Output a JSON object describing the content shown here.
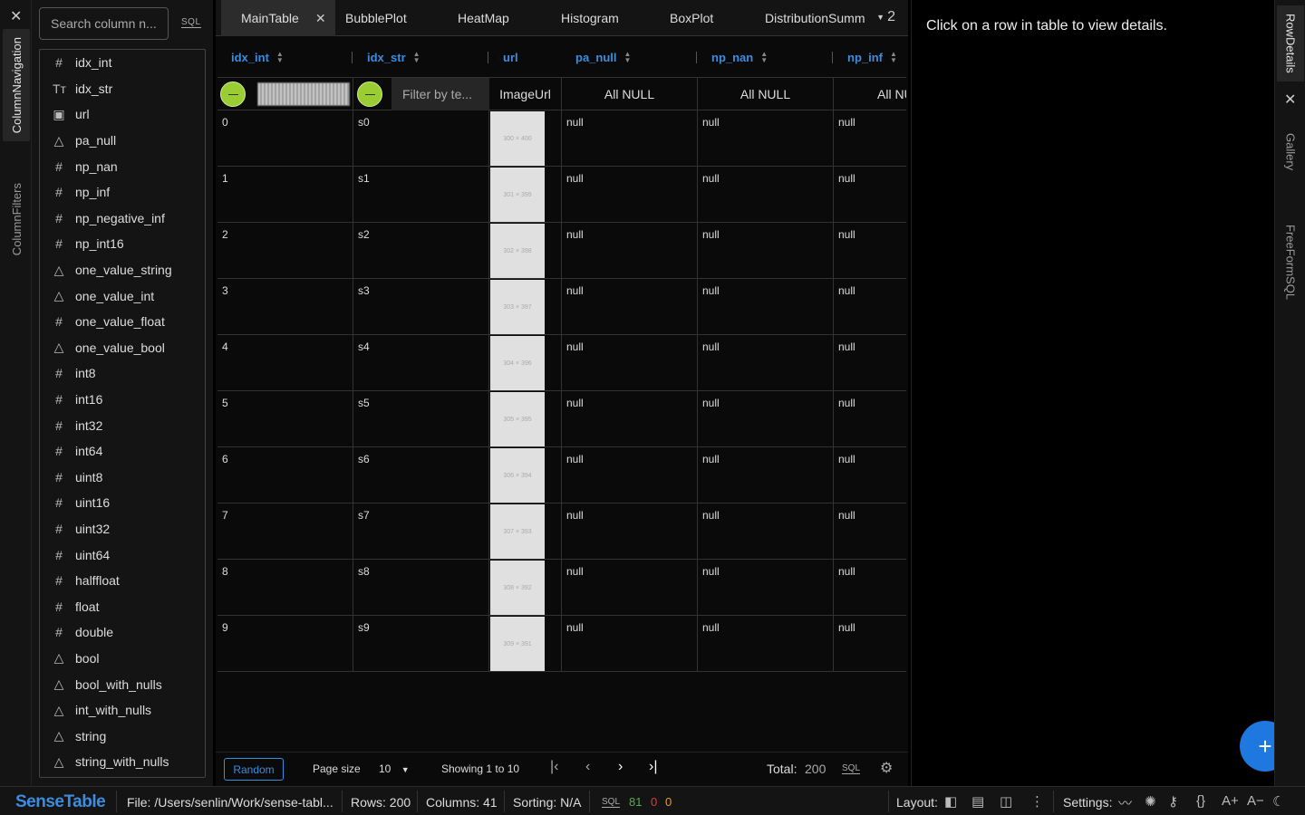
{
  "left_panel": {
    "tabs": [
      "ColumnNavigation",
      "ColumnFilters"
    ],
    "search_placeholder": "Search column n...",
    "sql_label": "SQL",
    "columns": [
      {
        "icon": "#",
        "name": "idx_int"
      },
      {
        "icon": "Tт",
        "name": "idx_str"
      },
      {
        "icon": "▣",
        "name": "url"
      },
      {
        "icon": "△",
        "name": "pa_null"
      },
      {
        "icon": "#",
        "name": "np_nan"
      },
      {
        "icon": "#",
        "name": "np_inf"
      },
      {
        "icon": "#",
        "name": "np_negative_inf"
      },
      {
        "icon": "#",
        "name": "np_int16"
      },
      {
        "icon": "△",
        "name": "one_value_string"
      },
      {
        "icon": "△",
        "name": "one_value_int"
      },
      {
        "icon": "#",
        "name": "one_value_float"
      },
      {
        "icon": "△",
        "name": "one_value_bool"
      },
      {
        "icon": "#",
        "name": "int8"
      },
      {
        "icon": "#",
        "name": "int16"
      },
      {
        "icon": "#",
        "name": "int32"
      },
      {
        "icon": "#",
        "name": "int64"
      },
      {
        "icon": "#",
        "name": "uint8"
      },
      {
        "icon": "#",
        "name": "uint16"
      },
      {
        "icon": "#",
        "name": "uint32"
      },
      {
        "icon": "#",
        "name": "uint64"
      },
      {
        "icon": "#",
        "name": "halffloat"
      },
      {
        "icon": "#",
        "name": "float"
      },
      {
        "icon": "#",
        "name": "double"
      },
      {
        "icon": "△",
        "name": "bool"
      },
      {
        "icon": "△",
        "name": "bool_with_nulls"
      },
      {
        "icon": "△",
        "name": "int_with_nulls"
      },
      {
        "icon": "△",
        "name": "string"
      },
      {
        "icon": "△",
        "name": "string_with_nulls"
      }
    ]
  },
  "tabs": {
    "items": [
      "MainTable",
      "BubblePlot",
      "HeatMap",
      "Histogram",
      "BoxPlot",
      "DistributionSumm"
    ],
    "active": "MainTable",
    "overflow_count": "2"
  },
  "table": {
    "headers": [
      "idx_int",
      "idx_str",
      "url",
      "pa_null",
      "np_nan",
      "np_inf"
    ],
    "filters": {
      "str_placeholder": "Filter by te...",
      "url": "ImageUrl",
      "pa_null": "All NULL",
      "np_nan": "All NULL",
      "np_inf": "All NU"
    },
    "rows": [
      {
        "idx_int": "0",
        "idx_str": "s0",
        "img": "300 × 400",
        "pa_null": "null",
        "np_nan": "null",
        "np_inf": "null"
      },
      {
        "idx_int": "1",
        "idx_str": "s1",
        "img": "301 × 399",
        "pa_null": "null",
        "np_nan": "null",
        "np_inf": "null"
      },
      {
        "idx_int": "2",
        "idx_str": "s2",
        "img": "302 × 398",
        "pa_null": "null",
        "np_nan": "null",
        "np_inf": "null"
      },
      {
        "idx_int": "3",
        "idx_str": "s3",
        "img": "303 × 397",
        "pa_null": "null",
        "np_nan": "null",
        "np_inf": "null"
      },
      {
        "idx_int": "4",
        "idx_str": "s4",
        "img": "304 × 396",
        "pa_null": "null",
        "np_nan": "null",
        "np_inf": "null"
      },
      {
        "idx_int": "5",
        "idx_str": "s5",
        "img": "305 × 395",
        "pa_null": "null",
        "np_nan": "null",
        "np_inf": "null"
      },
      {
        "idx_int": "6",
        "idx_str": "s6",
        "img": "306 × 394",
        "pa_null": "null",
        "np_nan": "null",
        "np_inf": "null"
      },
      {
        "idx_int": "7",
        "idx_str": "s7",
        "img": "307 × 393",
        "pa_null": "null",
        "np_nan": "null",
        "np_inf": "null"
      },
      {
        "idx_int": "8",
        "idx_str": "s8",
        "img": "308 × 392",
        "pa_null": "null",
        "np_nan": "null",
        "np_inf": "null"
      },
      {
        "idx_int": "9",
        "idx_str": "s9",
        "img": "309 × 391",
        "pa_null": "null",
        "np_nan": "null",
        "np_inf": "null"
      }
    ]
  },
  "footer": {
    "random_label": "Random",
    "page_size_label": "Page size",
    "page_size_value": "10",
    "showing": "Showing 1 to 10",
    "total_label": "Total:",
    "total_value": "200",
    "sql_label": "SQL"
  },
  "details": {
    "message": "Click on a row in table to view details."
  },
  "right_panel": {
    "tabs": [
      "RowDetails",
      "Gallery",
      "FreeFormSQL"
    ]
  },
  "status_bar": {
    "brand": "SenseTable",
    "file": "File: /Users/senlin/Work/sense-tabl...",
    "rows": "Rows: 200",
    "columns": "Columns: 41",
    "sorting": "Sorting: N/A",
    "sql_label": "SQL",
    "count_green": "81",
    "count_red": "0",
    "count_orange": "0",
    "layout_label": "Layout:",
    "settings_label": "Settings:"
  },
  "colors": {
    "accent": "#3b8de0",
    "knob": "#9acd32",
    "fab": "#1e78e0",
    "green": "#4caf50",
    "red": "#e53935",
    "orange": "#ff9800"
  }
}
